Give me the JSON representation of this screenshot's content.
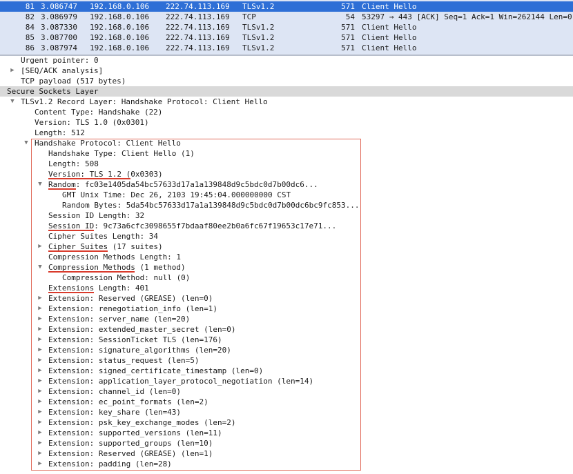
{
  "packets": [
    {
      "no": "81",
      "time": "3.086747",
      "src": "192.168.0.106",
      "dst": "222.74.113.169",
      "proto": "TLSv1.2",
      "len": "571",
      "info": "Client Hello",
      "selected": true
    },
    {
      "no": "82",
      "time": "3.086979",
      "src": "192.168.0.106",
      "dst": "222.74.113.169",
      "proto": "TCP",
      "len": "54",
      "info": "53297 → 443 [ACK] Seq=1 Ack=1 Win=262144 Len=0",
      "selected": false
    },
    {
      "no": "84",
      "time": "3.087330",
      "src": "192.168.0.106",
      "dst": "222.74.113.169",
      "proto": "TLSv1.2",
      "len": "571",
      "info": "Client Hello",
      "selected": false
    },
    {
      "no": "85",
      "time": "3.087700",
      "src": "192.168.0.106",
      "dst": "222.74.113.169",
      "proto": "TLSv1.2",
      "len": "571",
      "info": "Client Hello",
      "selected": false
    },
    {
      "no": "86",
      "time": "3.087974",
      "src": "192.168.0.106",
      "dst": "222.74.113.169",
      "proto": "TLSv1.2",
      "len": "571",
      "info": "Client Hello",
      "selected": false
    }
  ],
  "details": [
    {
      "text": "Urgent pointer: 0",
      "level": 1,
      "toggle": "none"
    },
    {
      "text": "[SEQ/ACK analysis]",
      "level": 1,
      "toggle": "collapsed"
    },
    {
      "text": "TCP payload (517 bytes)",
      "level": 1,
      "toggle": "none"
    },
    {
      "text": "Secure Sockets Layer",
      "level": 0,
      "toggle": "none",
      "section": true
    },
    {
      "text": "TLSv1.2 Record Layer: Handshake Protocol: Client Hello",
      "level": 1,
      "toggle": "expanded"
    },
    {
      "text": "Content Type: Handshake (22)",
      "level": 2,
      "toggle": "none"
    },
    {
      "text": "Version: TLS 1.0 (0x0301)",
      "level": 2,
      "toggle": "none"
    },
    {
      "text": "Length: 512",
      "level": 2,
      "toggle": "none"
    },
    {
      "text": "Handshake Protocol: Client Hello",
      "level": 2,
      "toggle": "expanded"
    },
    {
      "text": "Handshake Type: Client Hello (1)",
      "level": 3,
      "toggle": "none"
    },
    {
      "text": "Length: 508",
      "level": 3,
      "toggle": "none"
    },
    {
      "text": "Version: TLS 1.2 (0x0303)",
      "level": 3,
      "toggle": "none",
      "underline": 18
    },
    {
      "text": "Random: fc03e1405da54bc57633d17a1a139848d9c5bdc0d7b00dc6...",
      "level": 3,
      "toggle": "expanded",
      "underline": 6
    },
    {
      "text": "GMT Unix Time: Dec 26, 2103 19:45:04.000000000 CST",
      "level": 4,
      "toggle": "none"
    },
    {
      "text": "Random Bytes: 5da54bc57633d17a1a139848d9c5bdc0d7b00dc6bc9fc853...",
      "level": 4,
      "toggle": "none"
    },
    {
      "text": "Session ID Length: 32",
      "level": 3,
      "toggle": "none"
    },
    {
      "text": "Session ID: 9c73a6cfc3098655f7bdaaf80ee2b0a6fc67f19653c17e71...",
      "level": 3,
      "toggle": "none",
      "underline": 10
    },
    {
      "text": "Cipher Suites Length: 34",
      "level": 3,
      "toggle": "none"
    },
    {
      "text": "Cipher Suites (17 suites)",
      "level": 3,
      "toggle": "collapsed",
      "underline": 13
    },
    {
      "text": "Compression Methods Length: 1",
      "level": 3,
      "toggle": "none"
    },
    {
      "text": "Compression Methods (1 method)",
      "level": 3,
      "toggle": "expanded",
      "underline": 19
    },
    {
      "text": "Compression Method: null (0)",
      "level": 4,
      "toggle": "none"
    },
    {
      "text": "Extensions Length: 401",
      "level": 3,
      "toggle": "none",
      "underline": 10
    },
    {
      "text": "Extension: Reserved (GREASE) (len=0)",
      "level": 3,
      "toggle": "collapsed"
    },
    {
      "text": "Extension: renegotiation_info (len=1)",
      "level": 3,
      "toggle": "collapsed"
    },
    {
      "text": "Extension: server_name (len=20)",
      "level": 3,
      "toggle": "collapsed"
    },
    {
      "text": "Extension: extended_master_secret (len=0)",
      "level": 3,
      "toggle": "collapsed"
    },
    {
      "text": "Extension: SessionTicket TLS (len=176)",
      "level": 3,
      "toggle": "collapsed"
    },
    {
      "text": "Extension: signature_algorithms (len=20)",
      "level": 3,
      "toggle": "collapsed"
    },
    {
      "text": "Extension: status_request (len=5)",
      "level": 3,
      "toggle": "collapsed"
    },
    {
      "text": "Extension: signed_certificate_timestamp (len=0)",
      "level": 3,
      "toggle": "collapsed"
    },
    {
      "text": "Extension: application_layer_protocol_negotiation (len=14)",
      "level": 3,
      "toggle": "collapsed"
    },
    {
      "text": "Extension: channel_id (len=0)",
      "level": 3,
      "toggle": "collapsed"
    },
    {
      "text": "Extension: ec_point_formats (len=2)",
      "level": 3,
      "toggle": "collapsed"
    },
    {
      "text": "Extension: key_share (len=43)",
      "level": 3,
      "toggle": "collapsed"
    },
    {
      "text": "Extension: psk_key_exchange_modes (len=2)",
      "level": 3,
      "toggle": "collapsed"
    },
    {
      "text": "Extension: supported_versions (len=11)",
      "level": 3,
      "toggle": "collapsed"
    },
    {
      "text": "Extension: supported_groups (len=10)",
      "level": 3,
      "toggle": "collapsed"
    },
    {
      "text": "Extension: Reserved (GREASE) (len=1)",
      "level": 3,
      "toggle": "collapsed"
    },
    {
      "text": "Extension: padding (len=28)",
      "level": 3,
      "toggle": "collapsed"
    }
  ],
  "colors": {
    "selected_row": "#2e6fd6",
    "packet_bg": "#dde5f4",
    "section_bg": "#d9d9d9",
    "highlight": "#e06a5a",
    "underline": "#d93a2b"
  }
}
